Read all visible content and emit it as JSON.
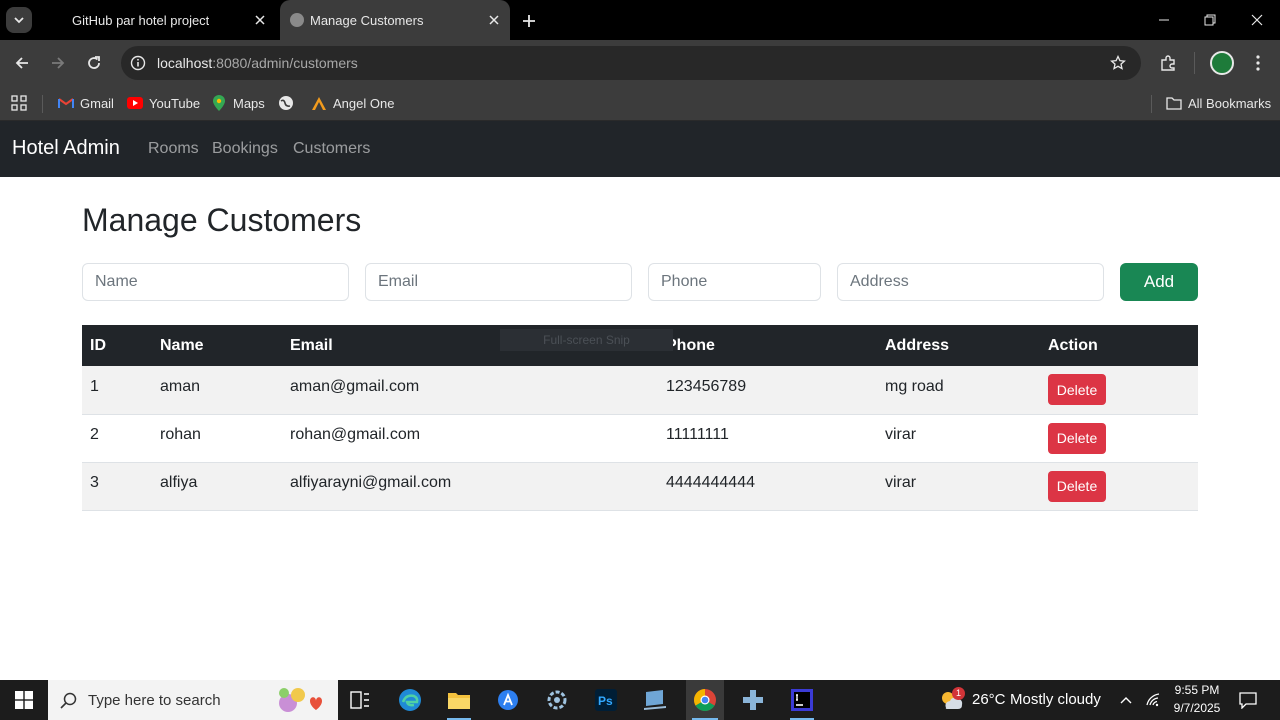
{
  "browser": {
    "tabs": [
      {
        "title": "GitHub par hotel project",
        "active": false
      },
      {
        "title": "Manage Customers",
        "active": true
      }
    ],
    "url_host": "localhost",
    "url_path": ":8080/admin/customers",
    "bookmarks": [
      {
        "label": "Gmail",
        "icon": "gmail-icon"
      },
      {
        "label": "YouTube",
        "icon": "youtube-icon"
      },
      {
        "label": "Maps",
        "icon": "maps-icon"
      },
      {
        "label": "",
        "icon": "globe-icon"
      },
      {
        "label": "Angel One",
        "icon": "angel-one-icon"
      }
    ],
    "all_bookmarks_label": "All Bookmarks"
  },
  "navbar": {
    "brand": "Hotel Admin",
    "links": [
      "Rooms",
      "Bookings",
      "Customers"
    ]
  },
  "page": {
    "title": "Manage Customers",
    "form": {
      "name_placeholder": "Name",
      "email_placeholder": "Email",
      "phone_placeholder": "Phone",
      "address_placeholder": "Address",
      "add_label": "Add"
    },
    "table": {
      "headers": [
        "ID",
        "Name",
        "Email",
        "Phone",
        "Address",
        "Action"
      ],
      "rows": [
        {
          "id": "1",
          "name": "aman",
          "email": "aman@gmail.com",
          "phone": "123456789",
          "address": "mg road",
          "action": "Delete"
        },
        {
          "id": "2",
          "name": "rohan",
          "email": "rohan@gmail.com",
          "phone": "11111111",
          "address": "virar",
          "action": "Delete"
        },
        {
          "id": "3",
          "name": "alfiya",
          "email": "alfiyarayni@gmail.com",
          "phone": "4444444444",
          "address": "virar",
          "action": "Delete"
        }
      ]
    },
    "snip_overlay": "Full-screen Snip"
  },
  "taskbar": {
    "search_placeholder": "Type here to search",
    "weather_badge": "1",
    "temperature": "26°C",
    "weather_text": "Mostly cloudy",
    "time": "9:55 PM",
    "date": "9/7/2025"
  },
  "colors": {
    "navbar_bg": "#212529",
    "add_button": "#198754",
    "delete_button": "#dc3545",
    "table_header_bg": "#212529"
  }
}
